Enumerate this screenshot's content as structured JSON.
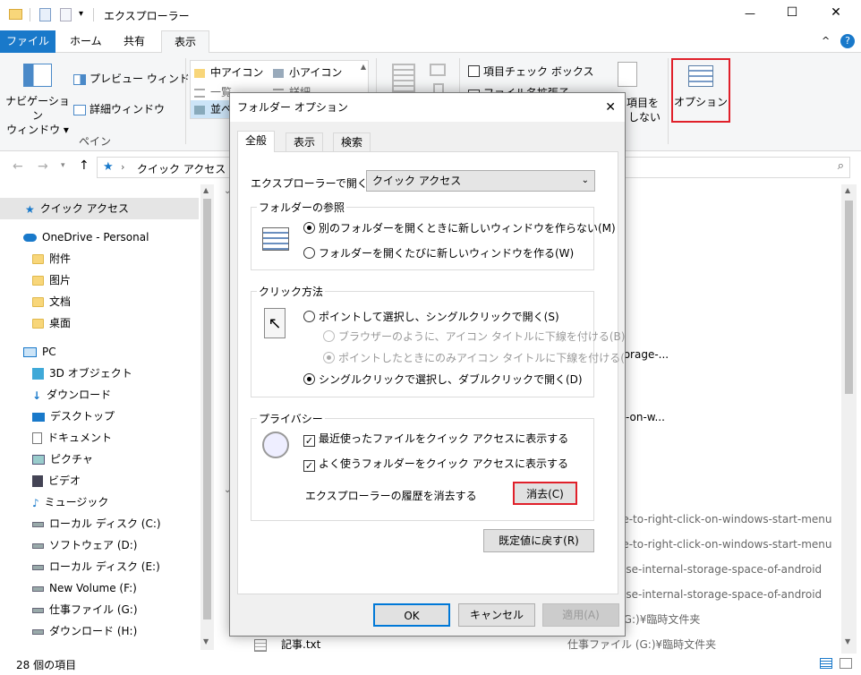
{
  "window": {
    "title": "エクスプローラー",
    "controls": {
      "minimize": "—",
      "maximize": "☐",
      "close": "✕"
    }
  },
  "ribbon_tabs": [
    "ファイル",
    "ホーム",
    "共有",
    "表示"
  ],
  "ribbon": {
    "nav_pane_label": "ナビゲーション ウィンドウ",
    "nav_pane_label_1": "ナビゲーション",
    "nav_pane_label_2": "ウィンドウ ▾",
    "preview_pane": "プレビュー ウィンドウ",
    "details_pane": "詳細ウィンドウ",
    "pane_group": "ペイン",
    "layout_items": [
      "中アイコン",
      "小アイコン",
      "一覧",
      "詳細",
      "並べ"
    ],
    "item_checkbox": "項目チェック ボックス",
    "file_ext_partial": "ファイル名拡張子",
    "hide_selected_partial_1": "項目を",
    "hide_selected_partial_2": "しない",
    "options": "オプション"
  },
  "address": {
    "path": "クイック アクセス",
    "search_icon": "search-icon"
  },
  "nav": {
    "quick_access": "クイック アクセス",
    "onedrive": "OneDrive - Personal",
    "folders": [
      "附件",
      "图片",
      "文档",
      "桌面"
    ],
    "pc": "PC",
    "pc_items": [
      "3D オブジェクト",
      "ダウンロード",
      "デスクトップ",
      "ドキュメント",
      "ピクチャ",
      "ビデオ",
      "ミュージック"
    ],
    "drives": [
      "ローカル ディスク (C:)",
      "ソフトウェア (D:)",
      "ローカル ディスク (E:)",
      "New Volume (F:)",
      "仕事ファイル (G:)",
      "ダウンロード (H:)"
    ]
  },
  "right_pane": {
    "rows": [
      {
        "name": "torage-...",
        "path": ""
      },
      {
        "name": "k-on-w...",
        "path": ""
      },
      {
        "name": "le-to-right-click-on-windows-start-menu",
        "path": ""
      },
      {
        "name": "le-to-right-click-on-windows-start-menu",
        "path": ""
      },
      {
        "name": "ase-internal-storage-space-of-android",
        "path": ""
      },
      {
        "name": "ase-internal-storage-space-of-android",
        "path": ""
      },
      {
        "name": "(G:)¥臨時文件夹",
        "path": ""
      },
      {
        "name": "記事.txt",
        "path": "仕事ファイル (G:)¥臨時文件夹"
      }
    ]
  },
  "status": {
    "items_count": "28 個の項目"
  },
  "dialog": {
    "title": "フォルダー オプション",
    "tabs": [
      "全般",
      "表示",
      "検索"
    ],
    "open_label": "エクスプローラーで開く:",
    "open_value": "クイック アクセス",
    "browse_group": "フォルダーの参照",
    "browse_opt1": "別のフォルダーを開くときに新しいウィンドウを作らない(M)",
    "browse_opt2": "フォルダーを開くたびに新しいウィンドウを作る(W)",
    "click_group": "クリック方法",
    "click_opt1": "ポイントして選択し、シングルクリックで開く(S)",
    "click_sub1": "ブラウザーのように、アイコン タイトルに下線を付ける(B)",
    "click_sub2": "ポイントしたときにのみアイコン タイトルに下線を付ける(",
    "click_opt2": "シングルクリックで選択し、ダブルクリックで開く(D)",
    "privacy_group": "プライバシー",
    "privacy_chk1": "最近使ったファイルをクイック アクセスに表示する",
    "privacy_chk2": "よく使うフォルダーをクイック アクセスに表示する",
    "clear_history_label": "エクスプローラーの履歴を消去する",
    "clear_button": "消去(C)",
    "restore_defaults": "既定値に戻す(R)",
    "ok": "OK",
    "cancel": "キャンセル",
    "apply": "適用(A)"
  }
}
